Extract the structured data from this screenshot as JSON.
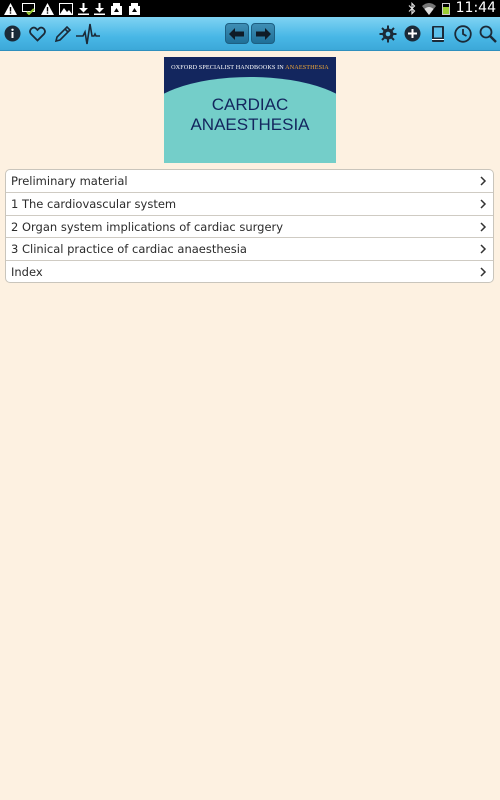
{
  "status_bar": {
    "time": "11:44",
    "left_icons": [
      "warning-icon",
      "cast-check-icon",
      "warning-icon",
      "image-icon",
      "download-icon",
      "download-icon",
      "gallery-upload-icon",
      "gallery-upload-icon"
    ],
    "right_icons": [
      "bluetooth-icon",
      "wifi-icon",
      "battery-icon"
    ]
  },
  "toolbar": {
    "left_buttons": [
      "info-icon",
      "favorite-icon",
      "edit-icon",
      "heartbeat-icon"
    ],
    "nav_buttons": [
      "back-arrow-icon",
      "forward-arrow-icon"
    ],
    "right_buttons": [
      "settings-icon",
      "add-icon",
      "book-icon",
      "history-icon",
      "search-icon"
    ]
  },
  "cover": {
    "series_prefix": "OXFORD SPECIALIST HANDBOOKS IN ",
    "series_accent": "ANAESTHESIA",
    "title_line1": "CARDIAC",
    "title_line2": "ANAESTHESIA",
    "colors": {
      "top": "#13265e",
      "teal": "#74cec9",
      "accent": "#f0a838"
    }
  },
  "toc": {
    "items": [
      {
        "label": "Preliminary material"
      },
      {
        "label": "1 The cardiovascular system"
      },
      {
        "label": "2 Organ system implications of cardiac surgery"
      },
      {
        "label": "3 Clinical practice of cardiac anaesthesia"
      },
      {
        "label": "Index"
      }
    ]
  },
  "colors": {
    "background": "#fdf1e1",
    "toolbar": "#48b7e6"
  }
}
